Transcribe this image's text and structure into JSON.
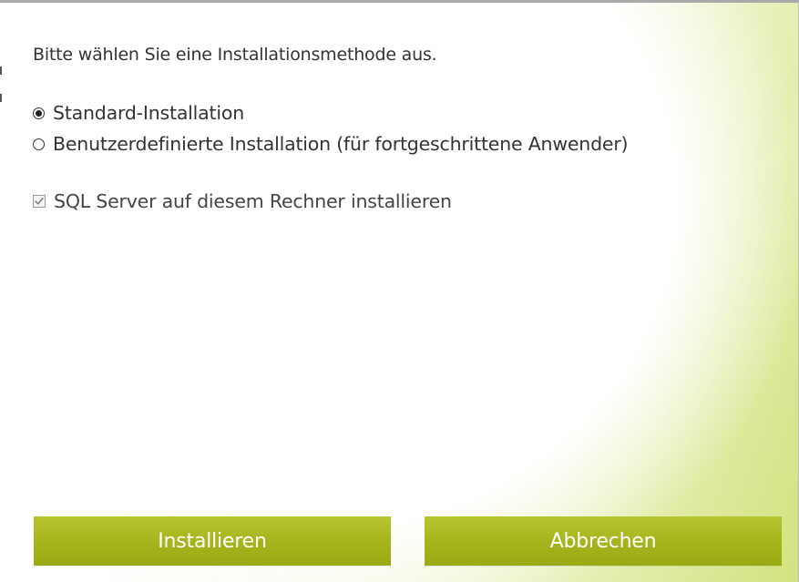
{
  "dialog": {
    "prompt": "Bitte wählen Sie eine Installationsmethode aus.",
    "installation_method": {
      "options": [
        {
          "label": "Standard-Installation",
          "selected": true
        },
        {
          "label": "Benutzerdefinierte Installation (für fortgeschrittene Anwender)",
          "selected": false
        }
      ]
    },
    "sql_server_checkbox": {
      "label": "SQL Server auf diesem Rechner installieren",
      "checked": true,
      "enabled": false
    },
    "buttons": {
      "install_label": "Installieren",
      "cancel_label": "Abbrechen"
    }
  },
  "colors": {
    "button": "#a6b51d",
    "button_text": "#ffffff",
    "accent_gradient": "#d3e280"
  }
}
